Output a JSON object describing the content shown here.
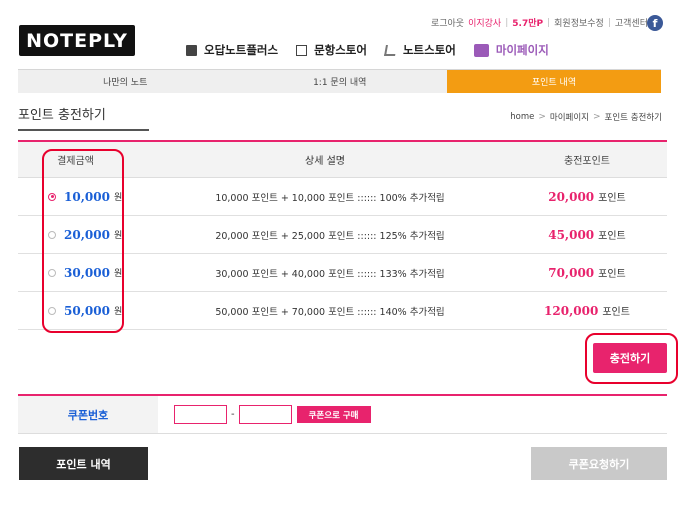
{
  "logo": "NOTEPLY",
  "util": {
    "logout": "로그아웃",
    "user": "이지강사",
    "points": "5.7만P",
    "edit_profile": "회원정보수정",
    "support": "고객센터",
    "fb": "f"
  },
  "gnb": [
    {
      "label": "오답노트플러스",
      "icon": "book-icon"
    },
    {
      "label": "문항스토어",
      "icon": "checkbox-icon"
    },
    {
      "label": "노트스토어",
      "icon": "cart-icon"
    },
    {
      "label": "마이페이지",
      "icon": "person-icon"
    }
  ],
  "tabs": [
    "나만의 노트",
    "1:1 문의 내역",
    "포인트 내역"
  ],
  "page_title": "포인트 충전하기",
  "breadcrumb": [
    "home",
    "마이페이지",
    "포인트 충전하기"
  ],
  "table": {
    "headers": [
      "결제금액",
      "상세 설명",
      "충전포인트"
    ],
    "rows": [
      {
        "amount": "10,000",
        "unit": "원",
        "desc": "10,000 포인트 + 10,000 포인트 :::::: 100% 추가적립",
        "points": "20,000",
        "pt_unit": "포인트",
        "selected": true
      },
      {
        "amount": "20,000",
        "unit": "원",
        "desc": "20,000 포인트 + 25,000 포인트 :::::: 125% 추가적립",
        "points": "45,000",
        "pt_unit": "포인트",
        "selected": false
      },
      {
        "amount": "30,000",
        "unit": "원",
        "desc": "30,000 포인트 + 40,000 포인트 :::::: 133% 추가적립",
        "points": "70,000",
        "pt_unit": "포인트",
        "selected": false
      },
      {
        "amount": "50,000",
        "unit": "원",
        "desc": "50,000 포인트 + 70,000 포인트 :::::: 140% 추가적립",
        "points": "120,000",
        "pt_unit": "포인트",
        "selected": false
      }
    ]
  },
  "charge_button": "충전하기",
  "coupon": {
    "label": "쿠폰번호",
    "separator": "-",
    "button": "쿠폰으로 구매"
  },
  "buttons": {
    "history": "포인트 내역",
    "request": "쿠폰요청하기"
  },
  "colors": {
    "accent": "#e8236d",
    "tab_active": "#f39c12",
    "amount_blue": "#1a5fd6",
    "highlight_red": "#e8002d"
  }
}
